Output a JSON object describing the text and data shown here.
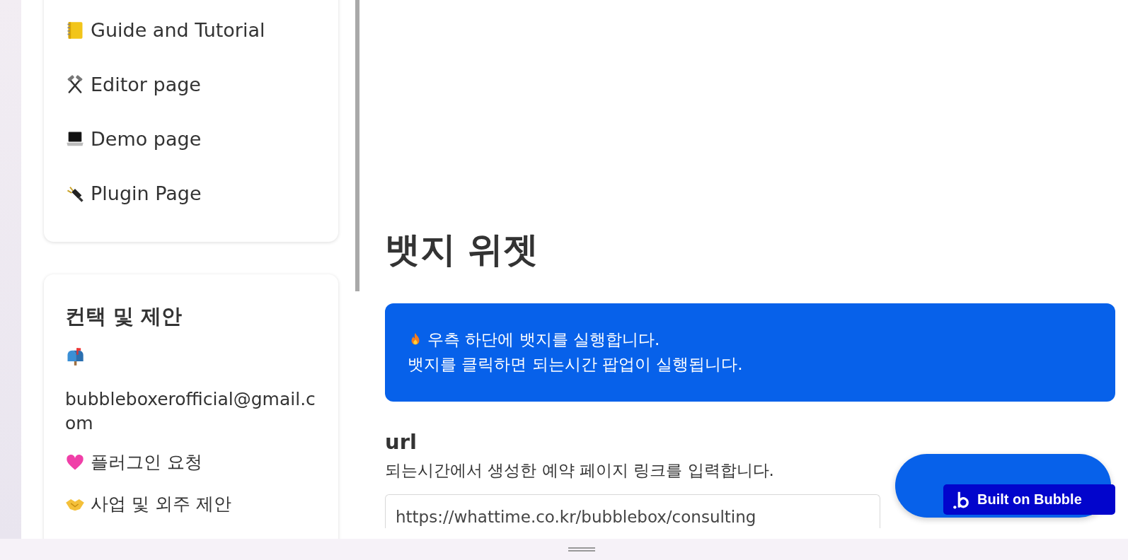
{
  "sidebar": {
    "nav_items": [
      {
        "label": "Guide and Tutorial"
      },
      {
        "label": "Editor page"
      },
      {
        "label": "Demo page"
      },
      {
        "label": "Plugin Page"
      }
    ],
    "contact": {
      "title": "컨택 및 제안",
      "items": [
        {
          "label": "bubbleboxerofficial@gmail.com"
        },
        {
          "label": "플러그인 요청"
        },
        {
          "label": "사업 및 외주 제안"
        }
      ]
    }
  },
  "main": {
    "title": "뱃지 위젯",
    "notice": {
      "lines": [
        "우측 하단에 뱃지를 실행합니다.",
        "뱃지를 클릭하면 되는시간 팝업이 실행됩니다."
      ]
    },
    "field": {
      "label": "url",
      "description": "되는시간에서 생성한 예약 페이지 링크를 입력합니다.",
      "value": "https://whattime.co.kr/bubblebox/consulting"
    }
  },
  "built_badge": {
    "label": "Built on Bubble"
  }
}
